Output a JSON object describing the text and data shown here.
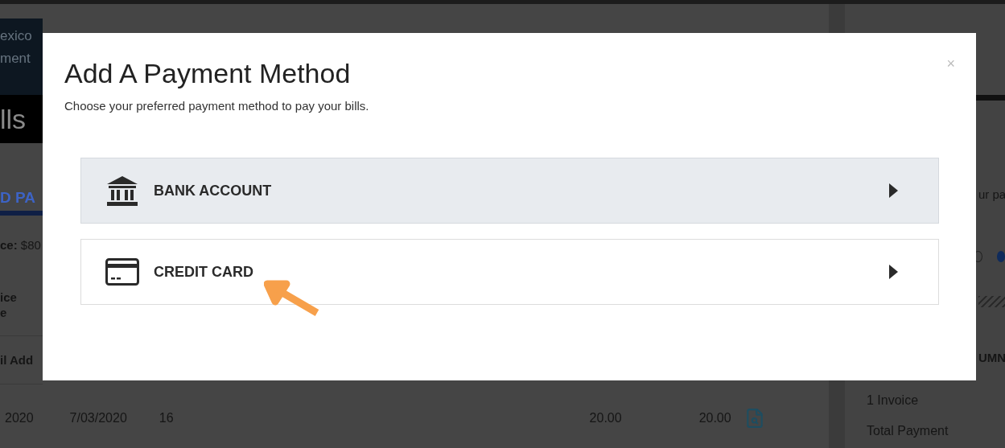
{
  "background": {
    "nav_lines": [
      "exico",
      "ment"
    ],
    "page_title": "lls",
    "tab": "D PA",
    "balance": "**ce:** $80",
    "header_lines": [
      "ice",
      "e"
    ],
    "column_header": "il Add",
    "row": [
      "2020",
      "7/03/2020",
      "16",
      "20.00",
      "20.00"
    ],
    "side": {
      "text": "ur pa",
      "radios": [
        {
          "selected": false
        },
        {
          "selected": true
        }
      ],
      "heading": "UMN",
      "summary": [
        "1 Invoice",
        "Total Payment"
      ]
    }
  },
  "modal": {
    "title": "Add A Payment Method",
    "subtitle": "Choose your preferred payment method to pay your bills.",
    "close": "×",
    "options": [
      {
        "kind": "bank",
        "label": "BANK ACCOUNT",
        "hovered": true,
        "pointed": false
      },
      {
        "kind": "card",
        "label": "CREDIT CARD",
        "hovered": false,
        "pointed": true
      }
    ]
  }
}
